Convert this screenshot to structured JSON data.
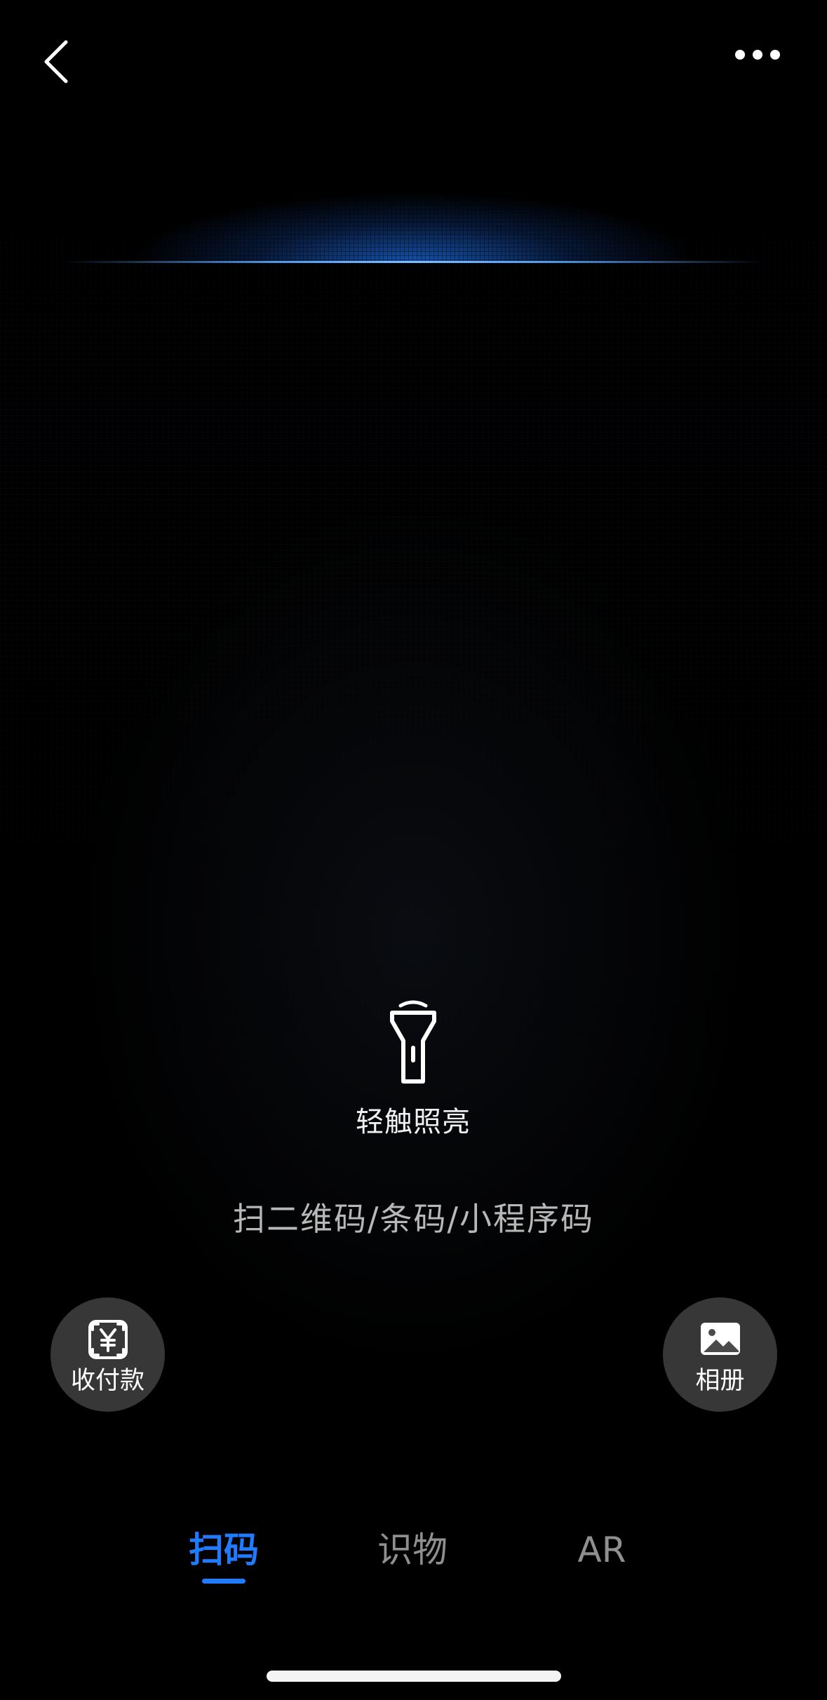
{
  "header": {
    "back_icon": "chevron-left-icon",
    "more_icon": "more-dots-icon"
  },
  "torch": {
    "icon": "flashlight-icon",
    "label": "轻触照亮"
  },
  "hint": {
    "text": "扫二维码/条码/小程序码"
  },
  "actions": {
    "pay": {
      "icon": "yuan-scan-icon",
      "label": "收付款"
    },
    "album": {
      "icon": "image-icon",
      "label": "相册"
    }
  },
  "tabs": [
    {
      "label": "扫码",
      "active": true
    },
    {
      "label": "识物",
      "active": false
    },
    {
      "label": "AR",
      "active": false
    }
  ],
  "colors": {
    "accent": "#1f7bff",
    "scan_glow": "#1e6ee6",
    "background": "#000000",
    "inactive_tab": "#8f8f8f"
  }
}
